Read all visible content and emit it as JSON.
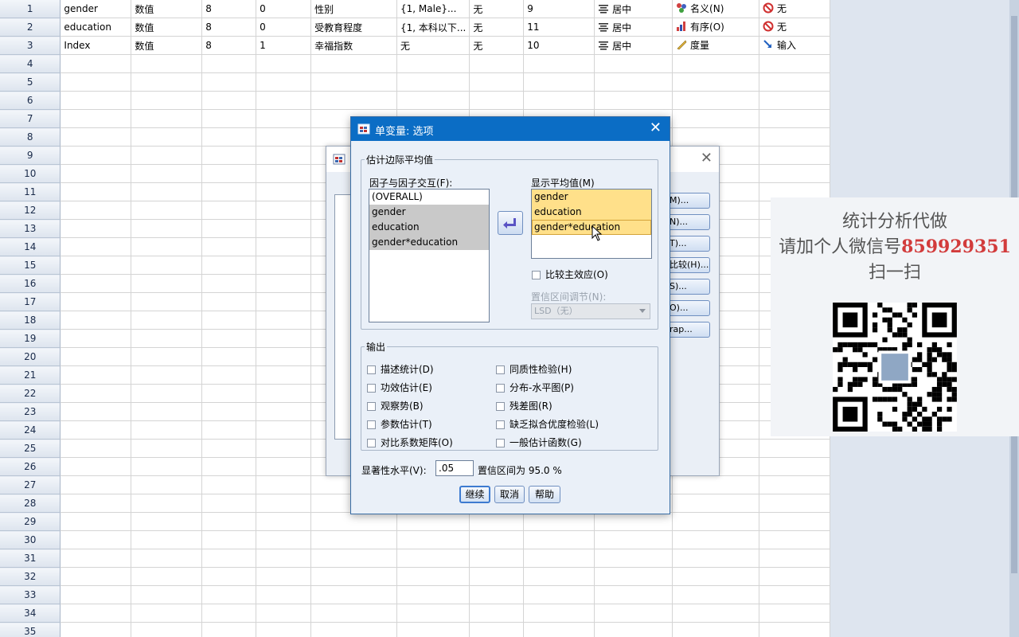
{
  "grid": {
    "rows": [
      {
        "num": "1",
        "name": "gender",
        "type": "数值",
        "width": "8",
        "decimals": "0",
        "label": "性别",
        "values": "{1, Male}...",
        "missing": "无",
        "columns": "9",
        "align": "居中",
        "measure": "名义(N)",
        "measure_icon": "nominal-icon",
        "role": "无",
        "role_icon": "none-icon"
      },
      {
        "num": "2",
        "name": "education",
        "type": "数值",
        "width": "8",
        "decimals": "0",
        "label": "受教育程度",
        "values": "{1, 本科以下...",
        "missing": "无",
        "columns": "11",
        "align": "居中",
        "measure": "有序(O)",
        "measure_icon": "ordinal-icon",
        "role": "无",
        "role_icon": "none-icon"
      },
      {
        "num": "3",
        "name": "Index",
        "type": "数值",
        "width": "8",
        "decimals": "1",
        "label": "幸福指数",
        "values": "无",
        "missing": "无",
        "columns": "10",
        "align": "居中",
        "measure": "度量",
        "measure_icon": "scale-icon",
        "role": "输入",
        "role_icon": "input-icon"
      }
    ],
    "empty_row_numbers": [
      "4",
      "5",
      "6",
      "7",
      "8",
      "9",
      "10",
      "11",
      "12",
      "13",
      "14",
      "15",
      "16",
      "17",
      "18",
      "19",
      "20",
      "21",
      "22",
      "23",
      "24",
      "25",
      "26",
      "27",
      "28",
      "29",
      "30",
      "31",
      "32",
      "33",
      "34",
      "35"
    ]
  },
  "back_dialog": {
    "buttons": [
      "M)...",
      "N)...",
      "T)...",
      "比较(H)...",
      "S)...",
      "O)...",
      "rap..."
    ]
  },
  "dialog": {
    "title": "单变量: 选项",
    "emm_group": "估计边际平均值",
    "factors_label": "因子与因子交互(F):",
    "factors": [
      "(OVERALL)",
      "gender",
      "education",
      "gender*education"
    ],
    "display_label": "显示平均值(M)",
    "display_means": [
      "gender",
      "education",
      "gender*education"
    ],
    "compare_main": "比较主效应(O)",
    "ci_adjust_label": "置信区间调节(N):",
    "ci_adjust_value": "LSD（无）",
    "output_group": "输出",
    "output_left": [
      "描述统计(D)",
      "功效估计(E)",
      "观察势(B)",
      "参数估计(T)",
      "对比系数矩阵(O)"
    ],
    "output_right": [
      "同质性检验(H)",
      "分布-水平图(P)",
      "残差图(R)",
      "缺乏拟合优度检验(L)",
      "一般估计函数(G)"
    ],
    "sig_label": "显著性水平(V):",
    "sig_value": ".05",
    "ci_text": "置信区间为 95.0 %",
    "btn_continue": "继续",
    "btn_cancel": "取消",
    "btn_help": "帮助"
  },
  "watermark": {
    "line1": "统计分析代做",
    "line2_prefix": "请加个人微信号",
    "line2_number": "859929351",
    "line3": "扫一扫"
  },
  "colors": {
    "title_bar": "#0b6dc5",
    "highlight": "#ffe08a",
    "watermark_number": "#d23b3b"
  }
}
